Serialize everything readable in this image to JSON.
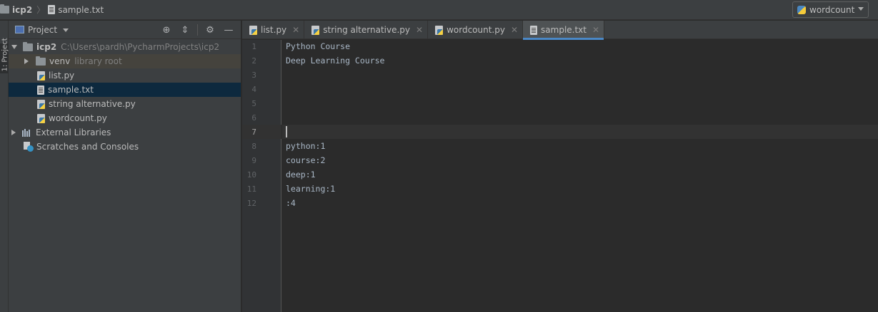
{
  "breadcrumb": {
    "project": "icp2",
    "file": "sample.txt"
  },
  "run_config": {
    "label": "wordcount"
  },
  "side_strip": {
    "tab_label": "1: Project"
  },
  "project_panel": {
    "title": "Project",
    "tree": {
      "root_name": "icp2",
      "root_path": "C:\\Users\\pardh\\PycharmProjects\\icp2",
      "venv_name": "venv",
      "venv_hint": "library root",
      "files": [
        "list.py",
        "sample.txt",
        "string alternative.py",
        "wordcount.py"
      ],
      "external_libraries": "External Libraries",
      "scratches": "Scratches and Consoles"
    }
  },
  "tabs": [
    {
      "label": "list.py",
      "icon": "python-file-icon"
    },
    {
      "label": "string alternative.py",
      "icon": "python-file-icon"
    },
    {
      "label": "wordcount.py",
      "icon": "python-file-icon"
    },
    {
      "label": "sample.txt",
      "icon": "text-file-icon",
      "active": true
    }
  ],
  "editor": {
    "line_numbers": [
      "1",
      "2",
      "3",
      "4",
      "5",
      "6",
      "7",
      "8",
      "9",
      "10",
      "11",
      "12"
    ],
    "current_line": "7",
    "lines": [
      "Python Course",
      "Deep Learning Course",
      "",
      "",
      "",
      "",
      "",
      "python:1",
      "course:2",
      "deep:1",
      "learning:1",
      ":4"
    ]
  },
  "colors": {
    "accent": "#4a88c7",
    "selection": "#0d293e",
    "library_root_bg": "#45433d"
  }
}
